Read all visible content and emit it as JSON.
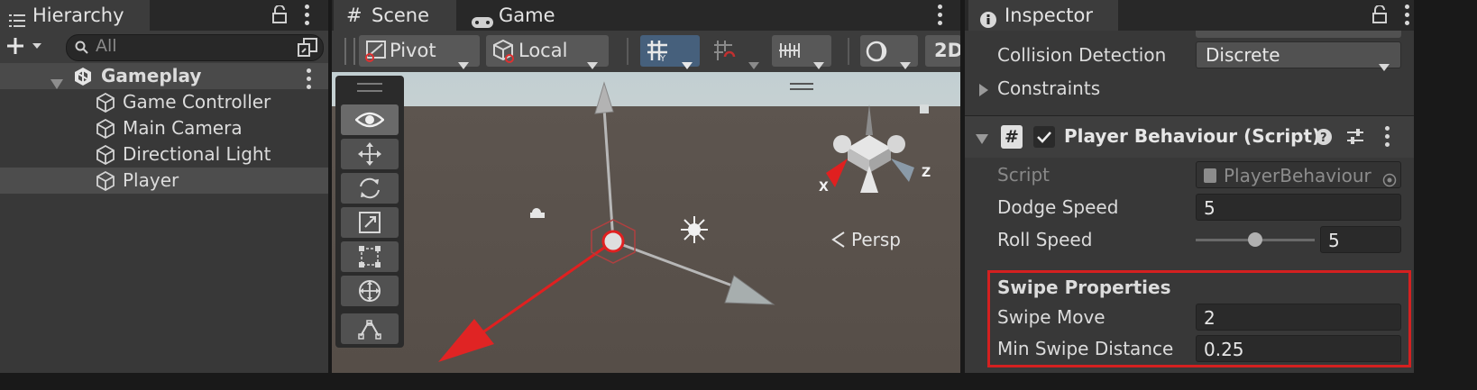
{
  "hierarchy": {
    "tab_label": "Hierarchy",
    "search_placeholder": "All",
    "scene_name": "Gameplay",
    "objects": [
      {
        "name": "Game Controller"
      },
      {
        "name": "Main Camera"
      },
      {
        "name": "Directional Light"
      },
      {
        "name": "Player",
        "selected": true
      }
    ]
  },
  "scene_view": {
    "tabs": [
      {
        "label": "Scene",
        "active": true
      },
      {
        "label": "Game",
        "active": false
      }
    ],
    "toolbar": {
      "pivot_label": "Pivot",
      "space_label": "Local",
      "mode_2d_label": "2D"
    },
    "projection_label": "Persp",
    "gizmo_axes": {
      "x": "X",
      "z": "Z"
    },
    "colors": {
      "sky": "#c6d0d2",
      "ground": "#5a524c",
      "selection_highlight": "#d42020"
    }
  },
  "inspector": {
    "tab_label": "Inspector",
    "rigidbody": {
      "collision_detection_label": "Collision Detection",
      "collision_detection_value": "Discrete",
      "constraints_label": "Constraints"
    },
    "component": {
      "title": "Player Behaviour (Script)",
      "enabled": true,
      "script_label": "Script",
      "script_value": "PlayerBehaviour",
      "dodge_speed_label": "Dodge Speed",
      "dodge_speed_value": "5",
      "roll_speed_label": "Roll Speed",
      "roll_speed_value": "5",
      "roll_speed_slider_fraction": 0.5,
      "swipe_header": "Swipe Properties",
      "swipe_move_label": "Swipe Move",
      "swipe_move_value": "2",
      "min_swipe_distance_label": "Min Swipe Distance",
      "min_swipe_distance_value": "0.25"
    }
  }
}
